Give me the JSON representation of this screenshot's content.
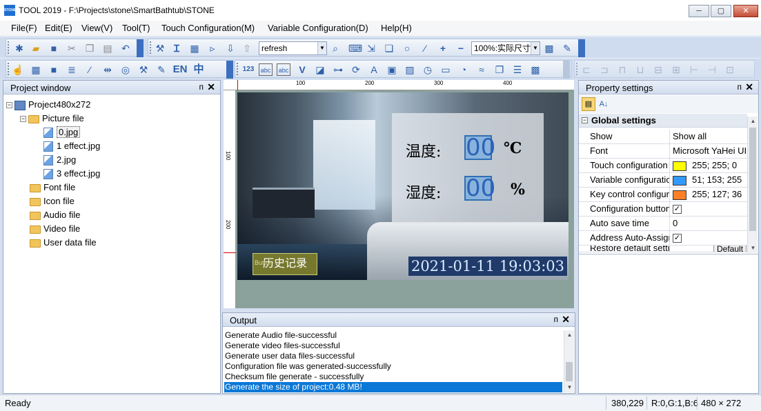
{
  "window": {
    "app_icon_text": "STONE",
    "title": "TOOL 2019 - F:\\Projects\\stone\\SmartBathtub\\STONE",
    "minimize": "─",
    "maximize": "▢",
    "close": "✕"
  },
  "menu": {
    "items": [
      {
        "label": "File(F)"
      },
      {
        "label": "Edit(E)"
      },
      {
        "label": "View(V)"
      },
      {
        "label": "Tool(T)"
      },
      {
        "label": "Touch Configuration(M)"
      },
      {
        "label": "Variable Configuration(D)"
      },
      {
        "label": "Help(H)"
      }
    ]
  },
  "toolbar": {
    "refresh_combo": "refresh",
    "zoom_combo": "100%:实际尺寸",
    "lang_en": "EN",
    "lang_zh": "中",
    "digit_icon": "123",
    "text_icon": "abc",
    "icons_row1": [
      "new-icon",
      "open-icon",
      "save-icon",
      "cut-icon",
      "copy-icon",
      "paste-icon",
      "undo-icon",
      "tools-icon",
      "text-cursor-icon",
      "calendar-icon",
      "export-icon",
      "download-icon",
      "upload-icon",
      "find-icon",
      "keyboard-icon",
      "import-icon",
      "window-icon",
      "zoom-icon",
      "eyedropper-icon",
      "plus-icon",
      "minus-icon",
      "calculator-icon",
      "paint-icon"
    ],
    "icons_row2": [
      "pointer-icon",
      "grid-icon",
      "square-icon",
      "list-indent-icon",
      "formula-icon",
      "align-icon",
      "circle-icon",
      "wrench-icon",
      "edit-icon"
    ]
  },
  "project_window": {
    "title": "Project window",
    "pin": "ᴨ",
    "close": "✕",
    "root": "Project480x272",
    "picture_folder": "Picture file",
    "pictures": [
      "0.jpg",
      "1 effect.jpg",
      "2.jpg",
      "3 effect.jpg"
    ],
    "other_folders": [
      "Font file",
      "Icon file",
      "Audio file",
      "Video file",
      "User data file"
    ]
  },
  "canvas": {
    "ruler_top_labels": [
      "100",
      "200",
      "300",
      "400"
    ],
    "ruler_left_labels": [
      "100",
      "200"
    ],
    "temp_label": "温度:",
    "temp_value": "00",
    "temp_unit": "℃",
    "humid_label": "湿度:",
    "humid_value": "00",
    "humid_unit": "%",
    "history_button": "历史记录",
    "history_button_tag": "Button",
    "datetime": "2021-01-11  19:03:03"
  },
  "properties": {
    "title": "Property settings",
    "pin": "ᴨ",
    "close": "✕",
    "section": "Global settings",
    "rows": [
      {
        "name": "Show",
        "value": "Show all"
      },
      {
        "name": "Font",
        "value": "Microsoft YaHei UI"
      },
      {
        "name": "Touch configuration",
        "value": "255; 255; 0",
        "color": "#ffff00"
      },
      {
        "name": "Variable configuration",
        "value": "51; 153; 255",
        "color": "#3399ff"
      },
      {
        "name": "Key control configuration",
        "value": "255; 127; 36",
        "color": "#ff7f24"
      },
      {
        "name": "Configuration button",
        "check": "✓"
      },
      {
        "name": "Auto save time",
        "value": "0"
      },
      {
        "name": "Address Auto-Assign",
        "check": "✓"
      },
      {
        "name": "Restore default settings",
        "value": "Default"
      }
    ]
  },
  "output": {
    "title": "Output",
    "pin": "ᴨ",
    "close": "✕",
    "lines": [
      "Generate Audio file-successful",
      "Generate video files-successful",
      "Generate user data files-successful",
      "Configuration file was generated-successfully",
      "Checksum file generate - successfully",
      "Generate the size of project:0.48 MB!"
    ]
  },
  "status": {
    "ready": "Ready",
    "coords": "380,229",
    "color": "R:0,G:1,B:6",
    "size": "480 × 272"
  },
  "colors": {
    "accent": "#0b78d7",
    "toolbar_end": "#3c6fbf"
  }
}
